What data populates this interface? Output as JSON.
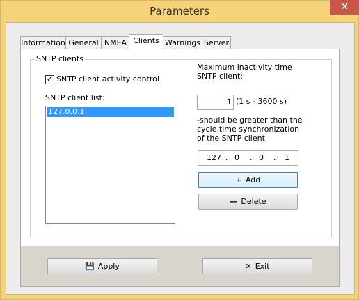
{
  "window": {
    "title": "Parameters",
    "close_glyph": "✕"
  },
  "tabs": [
    {
      "label": "Information",
      "active": false
    },
    {
      "label": "General",
      "active": false
    },
    {
      "label": "NMEA",
      "active": false
    },
    {
      "label": "Clients",
      "active": true
    },
    {
      "label": "Warnings",
      "active": false
    },
    {
      "label": "Server",
      "active": false
    }
  ],
  "group": {
    "title": "SNTP clients",
    "activity_control": {
      "label": "SNTP client activity control",
      "checked": true,
      "check_glyph": "✓"
    },
    "list_label": "SNTP client list:",
    "list_items": [
      "127.0.0.1"
    ],
    "max_inactivity_label": "Maximum inactivity time SNTP client:",
    "max_inactivity_value": "1",
    "max_inactivity_range": "(1 s - 3600 s)",
    "note": "-should be greater than the cycle time synchronization of the SNTP client",
    "ip_octets": [
      "127",
      "0",
      "0",
      "1"
    ],
    "ip_dot": ".",
    "add_label": "Add",
    "delete_label": "Delete",
    "add_icon": "+",
    "delete_icon": "—"
  },
  "footer": {
    "apply_label": "Apply",
    "exit_label": "Exit",
    "apply_icon": "💾",
    "exit_icon": "✕"
  },
  "colors": {
    "titlebar": "#f6d27b",
    "close": "#c8564a",
    "selection": "#3399ff"
  }
}
